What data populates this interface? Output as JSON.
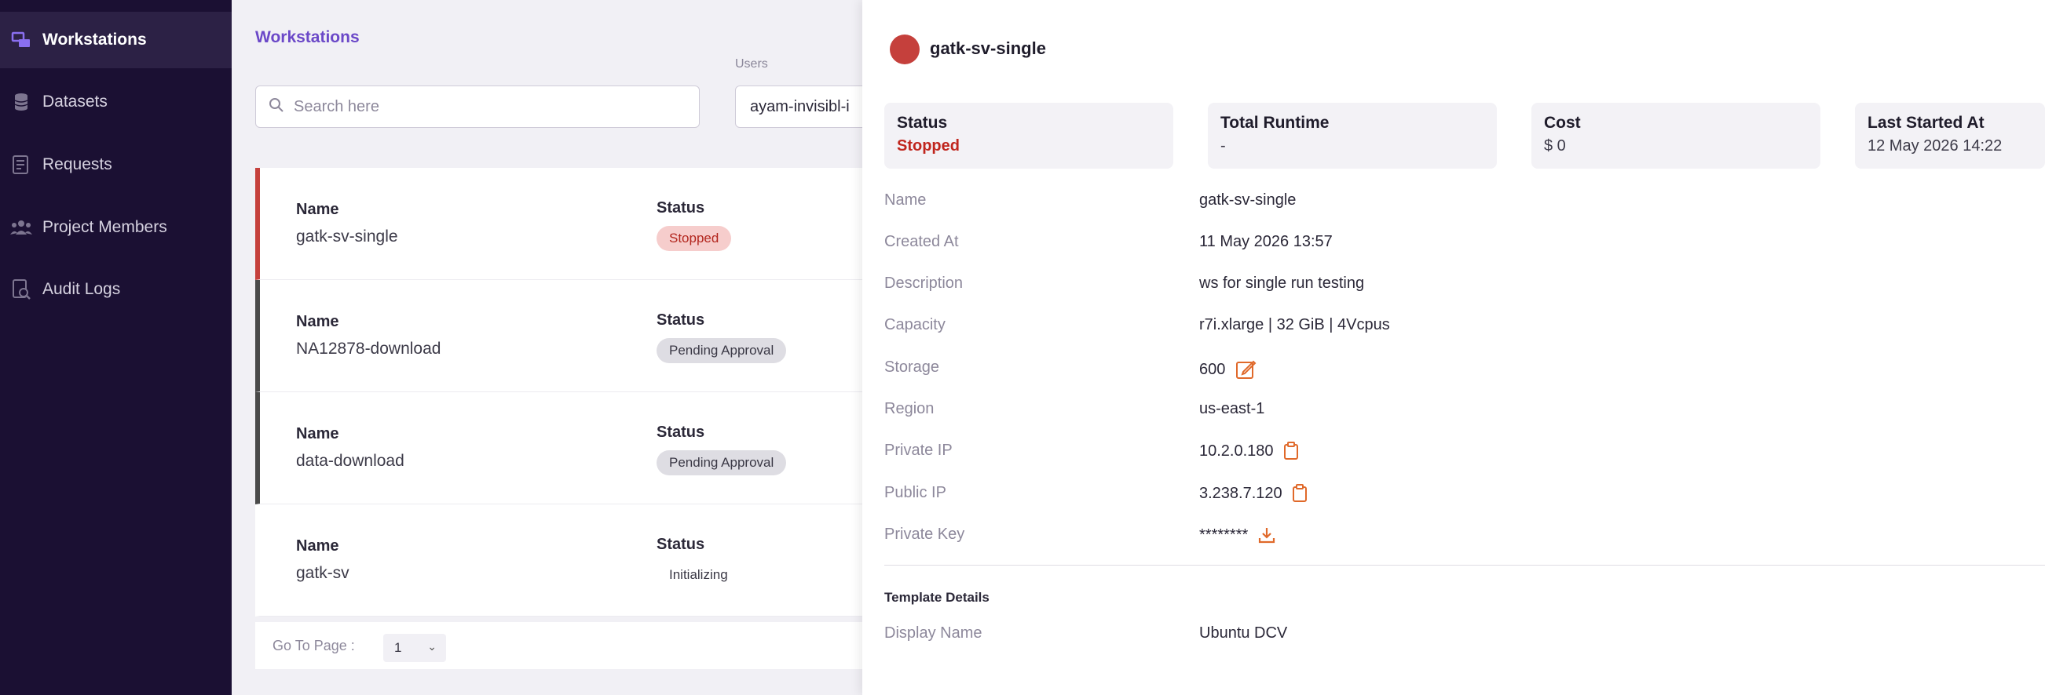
{
  "sidebar": {
    "items": [
      {
        "label": "Workstations",
        "icon": "workstation-icon",
        "active": true
      },
      {
        "label": "Datasets",
        "icon": "database-icon",
        "active": false
      },
      {
        "label": "Requests",
        "icon": "requests-icon",
        "active": false
      },
      {
        "label": "Project Members",
        "icon": "people-icon",
        "active": false
      },
      {
        "label": "Audit Logs",
        "icon": "audit-log-icon",
        "active": false
      }
    ]
  },
  "main": {
    "title": "Workstations",
    "search": {
      "placeholder": "Search here",
      "value": ""
    },
    "users": {
      "label": "Users",
      "value": "ayam-invisibl-i"
    },
    "workstations": [
      {
        "name_label": "Name",
        "name": "gatk-sv-single",
        "status_label": "Status",
        "status": "Stopped",
        "status_kind": "stopped",
        "accent": "#c5403c"
      },
      {
        "name_label": "Name",
        "name": "NA12878-download",
        "status_label": "Status",
        "status": "Pending Approval",
        "status_kind": "pending",
        "accent": "#4a4a4a"
      },
      {
        "name_label": "Name",
        "name": "data-download",
        "status_label": "Status",
        "status": "Pending Approval",
        "status_kind": "pending",
        "accent": "#4a4a4a"
      },
      {
        "name_label": "Name",
        "name": "gatk-sv",
        "status_label": "Status",
        "status": "Initializing",
        "status_kind": "init",
        "accent": "#ffffff"
      }
    ],
    "pager": {
      "label": "Go To Page :",
      "value": "1"
    }
  },
  "panel": {
    "title": "gatk-sv-single",
    "status_color": "#c5403c",
    "summary": [
      {
        "label": "Status",
        "value": "Stopped"
      },
      {
        "label": "Total Runtime",
        "value": "-"
      },
      {
        "label": "Cost",
        "value": "$ 0"
      },
      {
        "label": "Last Started At",
        "value": "12 May 2026 14:22"
      }
    ],
    "details": [
      {
        "label": "Name",
        "value": "gatk-sv-single"
      },
      {
        "label": "Created At",
        "value": "11 May 2026 13:57"
      },
      {
        "label": "Description",
        "value": "ws for single run testing"
      },
      {
        "label": "Capacity",
        "value": "r7i.xlarge | 32 GiB | 4Vcpus"
      },
      {
        "label": "Storage",
        "value": "600",
        "action_icon": "edit-icon"
      },
      {
        "label": "Region",
        "value": "us-east-1"
      },
      {
        "label": "Private IP",
        "value": "10.2.0.180",
        "action_icon": "copy-icon"
      },
      {
        "label": "Public IP",
        "value": "3.238.7.120",
        "action_icon": "copy-icon"
      },
      {
        "label": "Private Key",
        "value": "********",
        "action_icon": "download-icon"
      }
    ],
    "template_section": "Template Details",
    "template": [
      {
        "label": "Display Name",
        "value": "Ubuntu DCV"
      }
    ],
    "accent_color": "#e0692a"
  }
}
